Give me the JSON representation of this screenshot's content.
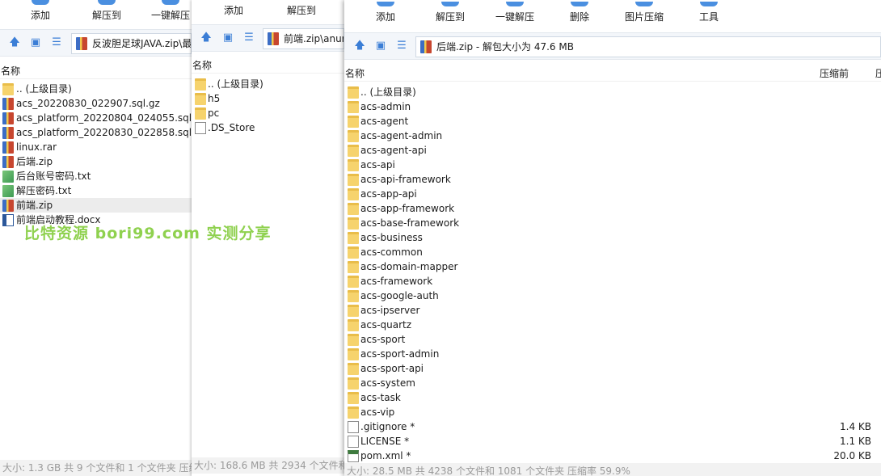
{
  "window1": {
    "toolbar": [
      {
        "label": "添加",
        "icon": "add-icon"
      },
      {
        "label": "解压到",
        "icon": "extract-to-icon"
      },
      {
        "label": "一键解压",
        "icon": "one-click-extract-icon"
      }
    ],
    "address": "反波胆足球JAVA.zip\\最",
    "column_name": "名称",
    "rows": [
      {
        "name": ".. (上级目录)",
        "icon": "folder-icon"
      },
      {
        "name": "acs_20220830_022907.sql.gz",
        "icon": "archive-icon"
      },
      {
        "name": "acs_platform_20220804_024055.sql.gz",
        "icon": "archive-icon"
      },
      {
        "name": "acs_platform_20220830_022858.sql.gz",
        "icon": "archive-icon"
      },
      {
        "name": "linux.rar",
        "icon": "archive-icon"
      },
      {
        "name": "后端.zip",
        "icon": "archive-icon"
      },
      {
        "name": "后台账号密码.txt",
        "icon": "text-file-icon"
      },
      {
        "name": "解压密码.txt",
        "icon": "text-file-icon"
      },
      {
        "name": "前端.zip",
        "icon": "archive-icon",
        "selected": true
      },
      {
        "name": "前端启动教程.docx",
        "icon": "word-file-icon"
      }
    ],
    "status": "大小: 1.3 GB 共 9 个文件和 1 个文件夹 压缩"
  },
  "window2": {
    "toolbar": [
      {
        "label": "添加"
      },
      {
        "label": "解压到"
      }
    ],
    "address": "前端.zip\\anur",
    "column_name": "名称",
    "rows": [
      {
        "name": ".. (上级目录)",
        "icon": "folder-icon"
      },
      {
        "name": "h5",
        "icon": "folder-icon"
      },
      {
        "name": "pc",
        "icon": "folder-icon"
      },
      {
        "name": ".DS_Store",
        "icon": "file-icon"
      }
    ],
    "status": "大小: 168.6 MB 共 2934 个文件和"
  },
  "window3": {
    "toolbar": [
      {
        "label": "添加",
        "icon": "add-icon"
      },
      {
        "label": "解压到",
        "icon": "extract-to-icon"
      },
      {
        "label": "一键解压",
        "icon": "one-click-extract-icon"
      },
      {
        "label": "删除",
        "icon": "delete-icon"
      },
      {
        "label": "图片压缩",
        "icon": "image-compress-icon"
      },
      {
        "label": "工具",
        "icon": "tools-icon"
      }
    ],
    "address": "后端.zip - 解包大小为 47.6 MB",
    "column_name": "名称",
    "column_compressed": "压缩前",
    "column_cut": "压",
    "rows": [
      {
        "name": ".. (上级目录)",
        "icon": "folder-icon",
        "size": ""
      },
      {
        "name": "acs-admin",
        "icon": "folder-icon",
        "size": ""
      },
      {
        "name": "acs-agent",
        "icon": "folder-icon",
        "size": ""
      },
      {
        "name": "acs-agent-admin",
        "icon": "folder-icon",
        "size": ""
      },
      {
        "name": "acs-agent-api",
        "icon": "folder-icon",
        "size": ""
      },
      {
        "name": "acs-api",
        "icon": "folder-icon",
        "size": ""
      },
      {
        "name": "acs-api-framework",
        "icon": "folder-icon",
        "size": ""
      },
      {
        "name": "acs-app-api",
        "icon": "folder-icon",
        "size": ""
      },
      {
        "name": "acs-app-framework",
        "icon": "folder-icon",
        "size": ""
      },
      {
        "name": "acs-base-framework",
        "icon": "folder-icon",
        "size": ""
      },
      {
        "name": "acs-business",
        "icon": "folder-icon",
        "size": ""
      },
      {
        "name": "acs-common",
        "icon": "folder-icon",
        "size": ""
      },
      {
        "name": "acs-domain-mapper",
        "icon": "folder-icon",
        "size": ""
      },
      {
        "name": "acs-framework",
        "icon": "folder-icon",
        "size": ""
      },
      {
        "name": "acs-google-auth",
        "icon": "folder-icon",
        "size": ""
      },
      {
        "name": "acs-ipserver",
        "icon": "folder-icon",
        "size": ""
      },
      {
        "name": "acs-quartz",
        "icon": "folder-icon",
        "size": ""
      },
      {
        "name": "acs-sport",
        "icon": "folder-icon",
        "size": ""
      },
      {
        "name": "acs-sport-admin",
        "icon": "folder-icon",
        "size": ""
      },
      {
        "name": "acs-sport-api",
        "icon": "folder-icon",
        "size": ""
      },
      {
        "name": "acs-system",
        "icon": "folder-icon",
        "size": ""
      },
      {
        "name": "acs-task",
        "icon": "folder-icon",
        "size": ""
      },
      {
        "name": "acs-vip",
        "icon": "folder-icon",
        "size": ""
      },
      {
        "name": ".gitignore *",
        "icon": "file-icon",
        "size": "1.4 KB"
      },
      {
        "name": "LICENSE *",
        "icon": "file-icon",
        "size": "1.1 KB"
      },
      {
        "name": "pom.xml *",
        "icon": "xml-file-icon",
        "size": "20.0 KB"
      }
    ],
    "status": "大小: 28.5 MB 共 4238 个文件和 1081 个文件夹 压缩率 59.9%"
  },
  "watermark": "比特资源 bori99.com 实测分享"
}
